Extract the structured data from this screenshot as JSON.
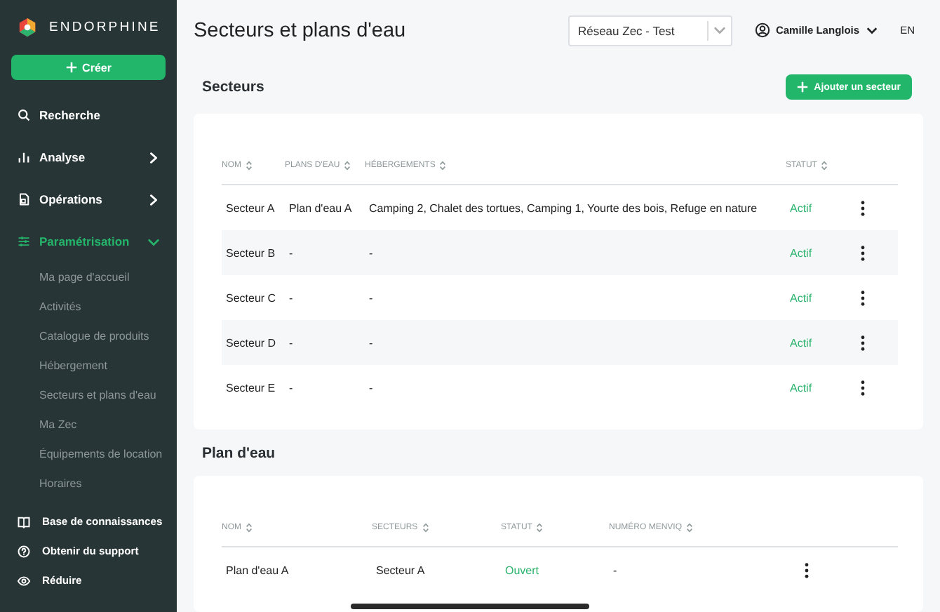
{
  "sidebar": {
    "brand": "ENDORPHINE",
    "create_button": "Créer",
    "items": [
      {
        "label": "Recherche"
      },
      {
        "label": "Analyse",
        "expanded": false
      },
      {
        "label": "Opérations",
        "expanded": false
      },
      {
        "label": "Paramétrisation",
        "expanded": true,
        "children": [
          {
            "label": "Ma page d'accueil"
          },
          {
            "label": "Activités"
          },
          {
            "label": "Catalogue de produits"
          },
          {
            "label": "Hébergement"
          },
          {
            "label": "Secteurs et plans d'eau"
          },
          {
            "label": "Ma Zec"
          },
          {
            "label": "Équipements de location"
          },
          {
            "label": "Horaires"
          }
        ]
      }
    ],
    "footer": [
      {
        "label": "Base de connaissances"
      },
      {
        "label": "Obtenir du support"
      },
      {
        "label": "Réduire"
      }
    ]
  },
  "header": {
    "title": "Secteurs et plans d'eau",
    "network_select": "Réseau Zec - Test",
    "user": "Camille Langlois",
    "language": "EN"
  },
  "sectors": {
    "title": "Secteurs",
    "add_button": "Ajouter un secteur",
    "columns": [
      "NOM",
      "PLANS D'EAU",
      "HÉBERGEMENTS",
      "STATUT"
    ],
    "rows": [
      [
        "Secteur A",
        "Plan d'eau A",
        "Camping 2, Chalet des tortues, Camping 1, Yourte des bois, Refuge en nature",
        "Actif"
      ],
      [
        "Secteur B",
        "-",
        "-",
        "Actif"
      ],
      [
        "Secteur C",
        "-",
        "-",
        "Actif"
      ],
      [
        "Secteur D",
        "-",
        "-",
        "Actif"
      ],
      [
        "Secteur E",
        "-",
        "-",
        "Actif"
      ]
    ]
  },
  "water_bodies": {
    "title": "Plan d'eau",
    "columns": [
      "NOM",
      "SECTEURS",
      "STATUT",
      "NUMÉRO MENVIQ"
    ],
    "rows": [
      [
        "Plan d'eau A",
        "Secteur A",
        "Ouvert",
        "-"
      ]
    ]
  }
}
